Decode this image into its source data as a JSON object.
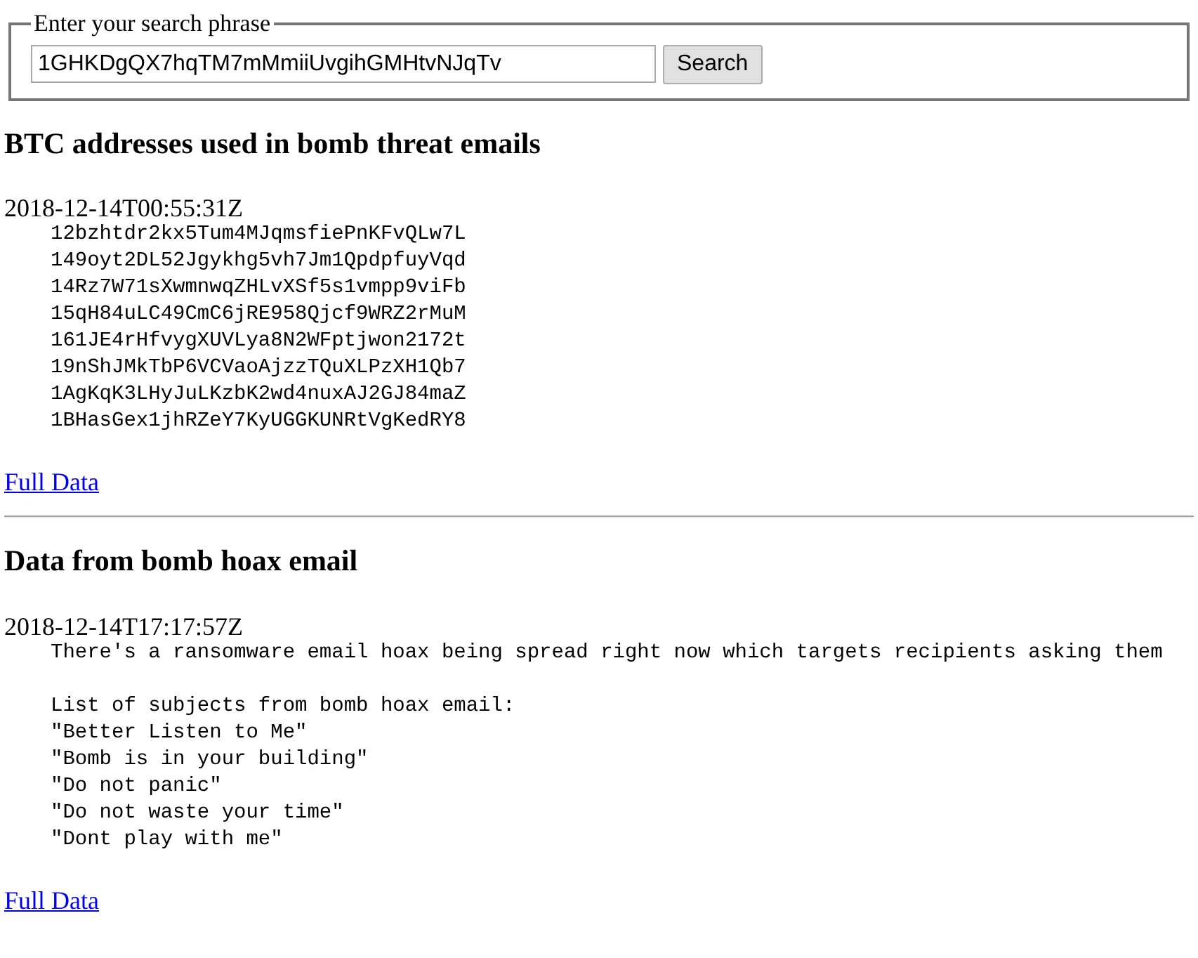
{
  "search": {
    "legend": "Enter your search phrase",
    "value": "1GHKDgQX7hqTM7mMmiiUvgihGMHtvNJqTv",
    "button": "Search"
  },
  "sections": [
    {
      "heading": "BTC addresses used in bomb threat emails",
      "timestamp": "2018-12-14T00:55:31Z",
      "blocks": [
        [
          "12bzhtdr2kx5Tum4MJqmsfiePnKFvQLw7L",
          "149oyt2DL52Jgykhg5vh7Jm1QpdpfuyVqd",
          "14Rz7W71sXwmnwqZHLvXSf5s1vmpp9viFb",
          "15qH84uLC49CmC6jRE958Qjcf9WRZ2rMuM",
          "161JE4rHfvygXUVLya8N2WFptjwon2172t",
          "19nShJMkTbP6VCVaoAjzzTQuXLPzXH1Qb7",
          "1AgKqK3LHyJuLKzbK2wd4nuxAJ2GJ84maZ",
          "1BHasGex1jhRZeY7KyUGGKUNRtVgKedRY8"
        ]
      ],
      "link": "Full Data"
    },
    {
      "heading": "Data from bomb hoax email",
      "timestamp": "2018-12-14T17:17:57Z",
      "blocks": [
        [
          "There's a ransomware email hoax being spread right now which targets recipients asking them"
        ],
        [
          "List of subjects from bomb hoax email:",
          "\"Better Listen to Me\"",
          "\"Bomb is in your building\"",
          "\"Do not panic\"",
          "\"Do not waste your time\"",
          "\"Dont play with me\""
        ]
      ],
      "link": "Full Data"
    }
  ]
}
